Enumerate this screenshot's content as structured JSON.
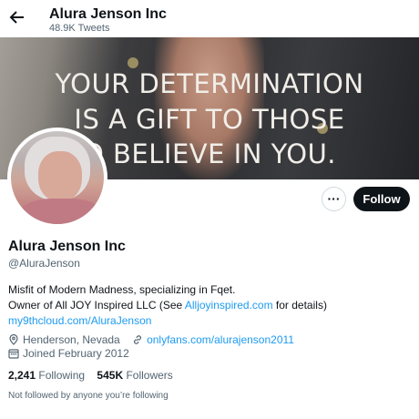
{
  "header": {
    "title": "Alura Jenson Inc",
    "tweets": "48.9K Tweets",
    "back_icon": "arrow-left-icon"
  },
  "banner": {
    "lines": [
      "YOUR DETERMINATION",
      "IS A GIFT TO THOSE",
      "O BELIEVE IN YOU."
    ]
  },
  "profile": {
    "name": "Alura Jenson Inc",
    "handle": "@AluraJenson",
    "bio_line1": "Misfit of Modern Madness, specializing in Fqet.",
    "bio_line2_prefix": "Owner of All JOY Inspired LLC (See ",
    "bio_line2_link": "Alljoyinspired.com",
    "bio_line2_suffix": " for details)",
    "bio_line3_link": "my9thcloud.com/AluraJenson",
    "location": "Henderson, Nevada",
    "website": "onlyfans.com/alurajenson2011",
    "joined": "Joined February 2012",
    "following_count": "2,241",
    "following_label": "Following",
    "followers_count": "545K",
    "followers_label": "Followers",
    "not_followed": "Not followed by anyone you’re following"
  },
  "actions": {
    "more_label": "···",
    "follow_label": "Follow"
  },
  "colors": {
    "accent": "#1d9bf0",
    "text": "#0f1419",
    "muted": "#536471"
  }
}
